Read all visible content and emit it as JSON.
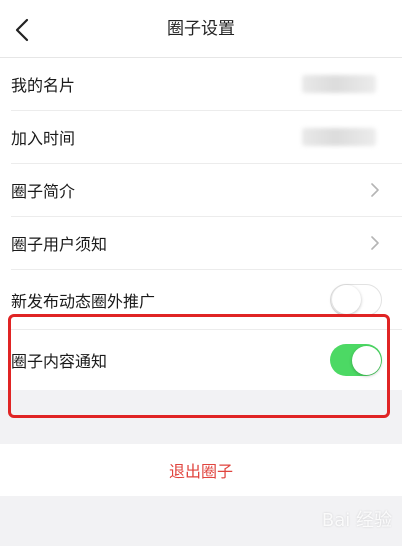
{
  "header": {
    "title": "圈子设置"
  },
  "settings": {
    "items": [
      {
        "label": "我的名片"
      },
      {
        "label": "加入时间"
      },
      {
        "label": "圈子简介"
      },
      {
        "label": "圈子用户须知"
      },
      {
        "label": "新发布动态圈外推广"
      },
      {
        "label": "圈子内容通知"
      }
    ],
    "toggles": {
      "promote_new_posts": false,
      "content_notification": true
    }
  },
  "actions": {
    "exit_label": "退出圈子"
  },
  "watermark": {
    "text": "Bai 经验"
  },
  "colors": {
    "accent_green": "#4cd964",
    "exit_red": "#e0443e",
    "highlight_red": "#e02424",
    "background": "#f2f2f4"
  },
  "icons": {
    "back": "chevron-left-icon",
    "disclosure": "chevron-right-icon"
  }
}
